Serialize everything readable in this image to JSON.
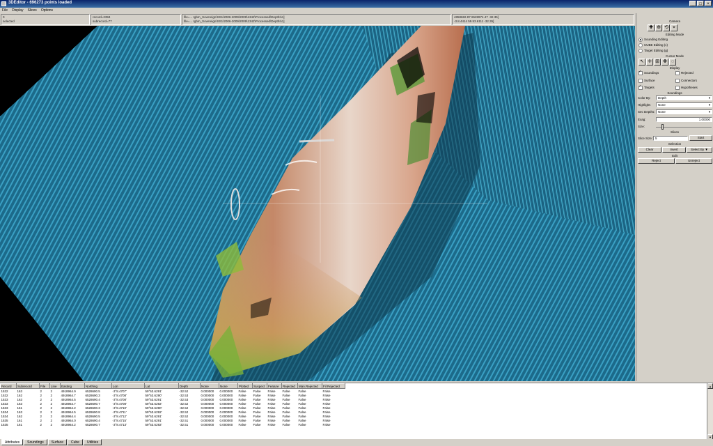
{
  "window": {
    "title": "3DEditor - 696273 points loaded",
    "min": "_",
    "max": "□",
    "close": "×"
  },
  "menu": [
    "File",
    "Display",
    "Slices",
    "Options"
  ],
  "info": {
    "box1": [
      "0",
      "selected"
    ],
    "box2": [
      "record=2394",
      "subrecord=77"
    ],
    "box3": [
      "file=... rgbm_Sovereign\\SS1\\2006-2009\\2009\\1342\\Processed\\Depths\\1]",
      "file=... rgbm_Sovereign\\SS1\\2006-2009\\2009\\1342\\Processed\\Depths\\1]"
    ],
    "box4": [
      "4858682.87  6528974.47 -32.35]",
      "-3.8.4414  59.53.6111 -32.35]"
    ]
  },
  "panel": {
    "camera": "Camera",
    "editing_mode": "Editing Mode",
    "modes": [
      "Sounding Editing",
      "CUBE Editing (c)",
      "Target Editing (g)"
    ],
    "cursor_mode": "Cursor Mode",
    "display": "Display",
    "display_checks": [
      {
        "label": "Soundings",
        "on": true
      },
      {
        "label": "Rejected",
        "on": false
      },
      {
        "label": "Surface",
        "on": false
      },
      {
        "label": "Connectors",
        "on": false
      },
      {
        "label": "Targets",
        "on": true
      },
      {
        "label": "Hypotheses",
        "on": false
      }
    ],
    "soundings": "Soundings",
    "color_by_label": "Color By:",
    "color_by": "Depth",
    "highlight_label": "Highlight:",
    "highlight": "None",
    "sec_depths_label": "Sec Depths:",
    "sec_depths": "None",
    "exag_label": "Exag:",
    "exag": "1.00000",
    "size_label": "Size:",
    "slices": "Slices",
    "slice_size_label": "Slice Size:",
    "slice_size": "5",
    "start": "Start",
    "selection": "Selection",
    "clear": "Clear",
    "invert": "Invert",
    "select_by": "Select By",
    "edit": "Edit",
    "reject": "Reject",
    "unreject": "Unreject"
  },
  "table": {
    "headers": [
      "Record",
      "Subrecord",
      "File",
      "Line",
      "Easting",
      "Northing",
      "Lon",
      "Lat",
      "Depth",
      "None",
      "None",
      "Plotted",
      "Suspect",
      "Feature",
      "Rejected",
      "Man.Rejected",
      "Fil Rejected"
    ],
    "rows": [
      [
        "1532",
        "163",
        "2",
        "2",
        "4918964.9",
        "6528690.5",
        "-3°8.4707'",
        "59°53.6291'",
        "-32.52",
        "0.000000",
        "0.000000",
        "False",
        "False",
        "False",
        "False",
        "False",
        "False"
      ],
      [
        "1532",
        "162",
        "2",
        "2",
        "4918964.7",
        "6528690.3",
        "-3°8.4708'",
        "59°53.6290'",
        "-32.53",
        "0.000000",
        "0.000000",
        "False",
        "False",
        "False",
        "False",
        "False",
        "False"
      ],
      [
        "1533",
        "163",
        "2",
        "2",
        "4918964.5",
        "6528690.4",
        "-3°8.4708'",
        "59°53.6291'",
        "-32.53",
        "0.000000",
        "0.000000",
        "False",
        "False",
        "False",
        "False",
        "False",
        "False"
      ],
      [
        "1533",
        "163",
        "2",
        "2",
        "4918964.7",
        "6528690.7",
        "-3°8.4708'",
        "59°53.6292'",
        "-32.52",
        "0.000000",
        "0.000000",
        "False",
        "False",
        "False",
        "False",
        "False",
        "False"
      ],
      [
        "1533",
        "161",
        "2",
        "2",
        "4918964.2",
        "6528690.3",
        "-3°8.4710'",
        "59°53.6290'",
        "-32.52",
        "0.000000",
        "0.000000",
        "False",
        "False",
        "False",
        "False",
        "False",
        "False"
      ],
      [
        "1534",
        "163",
        "2",
        "2",
        "4918964.5",
        "6528690.8",
        "-3°8.4711'",
        "59°53.6292'",
        "-32.52",
        "0.000000",
        "0.000000",
        "False",
        "False",
        "False",
        "False",
        "False",
        "False"
      ],
      [
        "1534",
        "162",
        "2",
        "2",
        "4918964.4",
        "6528690.5",
        "-3°8.4712'",
        "59°53.6291'",
        "-32.52",
        "0.000000",
        "0.000000",
        "False",
        "False",
        "False",
        "False",
        "False",
        "False"
      ],
      [
        "1535",
        "161",
        "2",
        "2",
        "4918964.0",
        "6528690.4",
        "-3°8.4715'",
        "59°53.6291'",
        "-32.51",
        "0.000000",
        "0.000000",
        "False",
        "False",
        "False",
        "False",
        "False",
        "False"
      ],
      [
        "1535",
        "161",
        "2",
        "2",
        "4918964.2",
        "6528690.7",
        "-3°8.4713'",
        "59°53.6292'",
        "-32.51",
        "0.000000",
        "0.000000",
        "False",
        "False",
        "False",
        "False",
        "False",
        "False"
      ]
    ]
  },
  "tabs": [
    "Attributes",
    "Soundings",
    "Surface",
    "Cube",
    "Utilities"
  ],
  "colors": {
    "seabed": "#1f6f8f",
    "wreck_top": "#e8d8cc",
    "wreck_mid": "#c0785a",
    "wreck_low": "#9cb83c"
  }
}
